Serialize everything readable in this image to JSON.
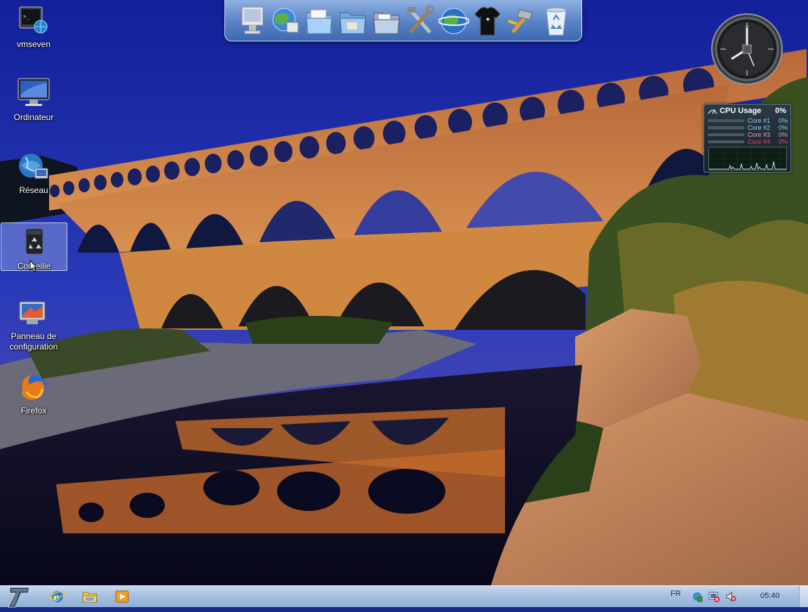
{
  "desktop": {
    "icons": [
      {
        "label": "vmseven",
        "icon": "vmseven-icon"
      },
      {
        "label": "Ordinateur",
        "icon": "computer-icon"
      },
      {
        "label": "Réseau",
        "icon": "network-icon"
      },
      {
        "label": "Corbeille",
        "icon": "recycle-bin-icon",
        "selected": true
      },
      {
        "label": "Panneau de\nconfiguration",
        "label_line1": "Panneau de",
        "label_line2": "configuration",
        "icon": "control-panel-icon"
      },
      {
        "label": "Firefox",
        "icon": "firefox-icon"
      }
    ]
  },
  "dock": {
    "items": [
      "computer-icon",
      "network-globe-icon",
      "documents-folder-icon",
      "folder-icon",
      "pictures-folder-icon",
      "tools-icon",
      "internet-globe-icon",
      "tshirt-icon",
      "hammer-icon",
      "recycle-bin-icon"
    ]
  },
  "cpu_gadget": {
    "title": "CPU Usage",
    "total": "0%",
    "cores": [
      {
        "name": "Core #1",
        "value": "0%",
        "color": "#8fd0e8"
      },
      {
        "name": "Core #2",
        "value": "0%",
        "color": "#8fd0e8"
      },
      {
        "name": "Core #3",
        "value": "0%",
        "color": "#e8a0c0"
      },
      {
        "name": "Core #4",
        "value": "0%",
        "color": "#e84060"
      }
    ]
  },
  "taskbar": {
    "pinned": [
      "internet-explorer-icon",
      "explorer-folder-icon",
      "media-player-icon"
    ],
    "language": "FR",
    "tray_icons": [
      "network-tray-icon",
      "action-center-icon",
      "volume-muted-icon"
    ],
    "time": "05:40"
  },
  "colors": {
    "sky_top": "#1a2898",
    "sky_bottom": "#5a4aa8",
    "bridge": "#c8763e",
    "taskbar": "#a7c0e0"
  }
}
